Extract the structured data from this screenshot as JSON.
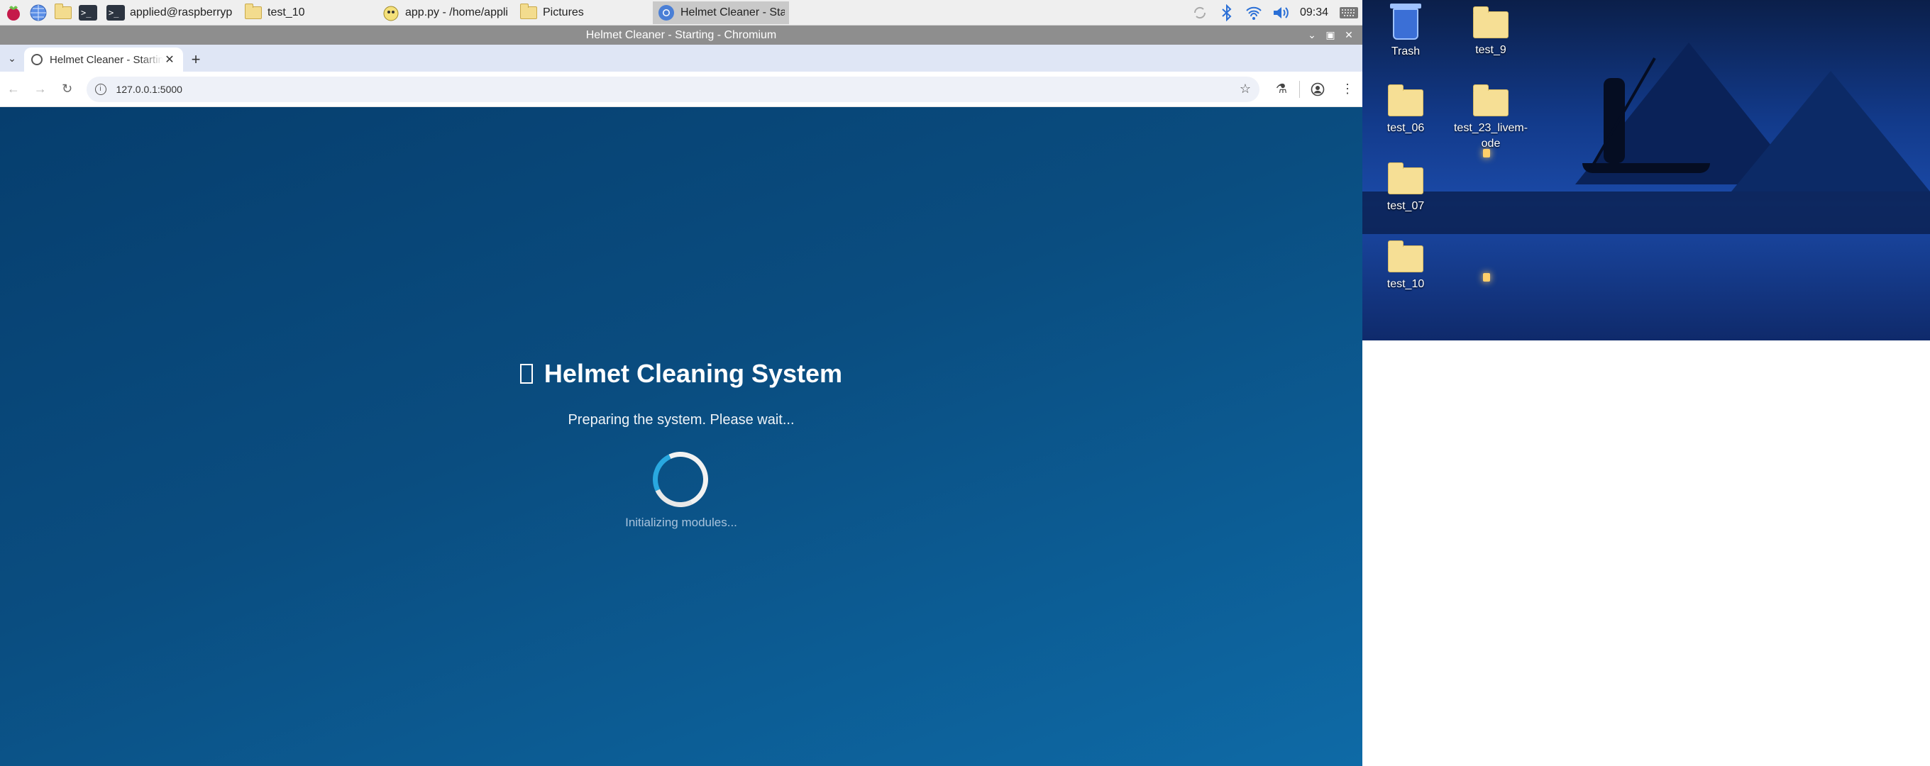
{
  "taskbar": {
    "tasks": [
      {
        "label": "applied@raspberrypi..."
      },
      {
        "label": "test_10"
      },
      {
        "label": "app.py - /home/appli..."
      },
      {
        "label": "Pictures"
      },
      {
        "label": "Helmet Cleaner - Star..."
      }
    ],
    "clock": "09:34"
  },
  "window": {
    "title": "Helmet Cleaner - Starting - Chromium"
  },
  "browser": {
    "tab_title": "Helmet Cleaner - Starting",
    "url": "127.0.0.1:5000"
  },
  "page": {
    "title": "Helmet Cleaning System",
    "subtitle": "Preparing the system. Please wait...",
    "status": "Initializing modules..."
  },
  "desktop": {
    "icons": [
      {
        "label": "Trash"
      },
      {
        "label": "test_9"
      },
      {
        "label": "test_06"
      },
      {
        "label": "test_23_livem-ode"
      },
      {
        "label": "test_07"
      },
      {
        "label": "test_10"
      }
    ]
  },
  "colors": {
    "page_bg_top": "#063e6e",
    "page_bg_bottom": "#0e6aa6",
    "spinner_accent": "#29a8e0"
  }
}
